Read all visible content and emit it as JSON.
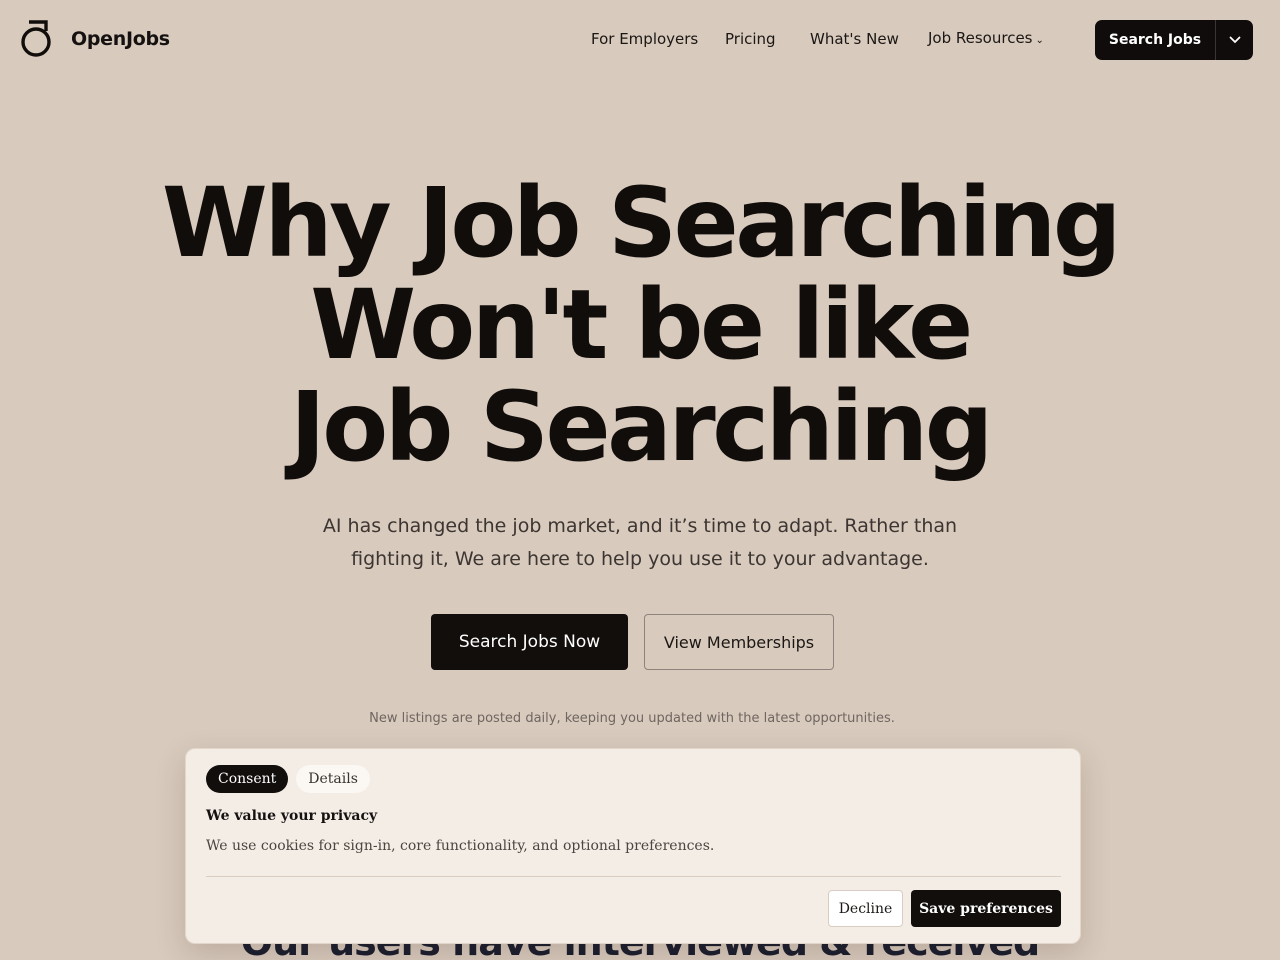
{
  "header": {
    "brand": "OpenJobs",
    "nav": [
      {
        "label": "For Employers"
      },
      {
        "label": "Pricing"
      },
      {
        "label": "What's New"
      },
      {
        "label": "Job Resources",
        "icon": "chevron-down-icon"
      }
    ],
    "cta_label": "Search Jobs",
    "cta_dropdown_icon": "chevron-down-icon"
  },
  "hero": {
    "title_line1": "Why Job Searching",
    "title_line2": "Won't be like",
    "title_line3": "Job Searching",
    "subtitle_line1": "AI has changed the job market, and it’s time to adapt. Rather than",
    "subtitle_line2": "fighting it, We are here to help you use it to your advantage.",
    "primary_button": "Search Jobs Now",
    "secondary_button": "View Memberships",
    "note": "New listings are posted daily, keeping you updated with the latest opportunities."
  },
  "below": {
    "heading_partial": "Our users have interviewed & received"
  },
  "consent": {
    "tabs": [
      {
        "label": "Consent",
        "active": true
      },
      {
        "label": "Details",
        "active": false
      }
    ],
    "title": "We value your privacy",
    "body": "We use cookies for sign-in, core functionality, and optional preferences.",
    "decline_label": "Decline",
    "save_label": "Save preferences"
  },
  "colors": {
    "background": "#d8cabd",
    "primary": "#120e0c",
    "modal_background": "#f4ede6"
  }
}
